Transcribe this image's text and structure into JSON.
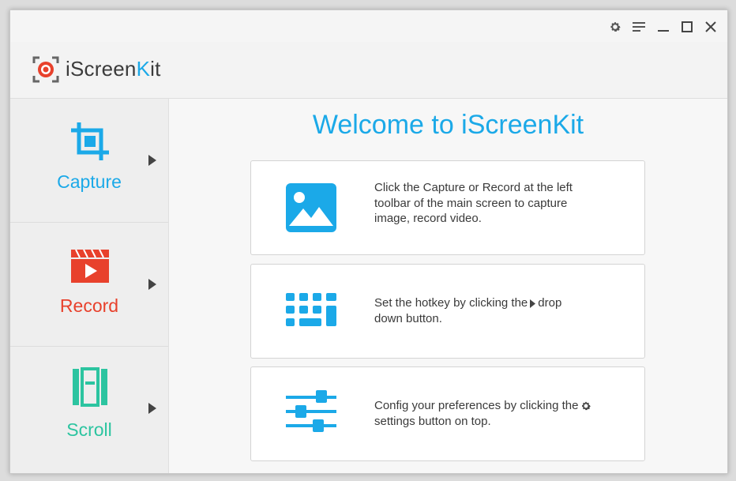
{
  "app": {
    "title_prefix": "iScreen",
    "title_k": "K",
    "title_suffix": "it"
  },
  "window_controls": [
    "gear-icon",
    "menu-icon",
    "minimize-icon",
    "maximize-icon",
    "close-icon"
  ],
  "sidebar": {
    "items": [
      {
        "label": "Capture",
        "icon": "crop-icon",
        "color": "#1ba9e8"
      },
      {
        "label": "Record",
        "icon": "video-record-icon",
        "color": "#e8412c"
      },
      {
        "label": "Scroll",
        "icon": "scroll-icon",
        "color": "#2cc4a0"
      }
    ]
  },
  "main": {
    "welcome": "Welcome to iScreenKit",
    "cards": [
      {
        "icon": "image-icon",
        "line1": "Click the Capture or Record at the left",
        "line2": "toolbar of the main screen to capture",
        "line3": "image, record video."
      },
      {
        "icon": "keyboard-icon",
        "line1_a": "Set the hotkey by clicking the",
        "line1_b": "drop",
        "line2": "down button."
      },
      {
        "icon": "sliders-icon",
        "line1": "Config your preferences by clicking the",
        "line2": "settings button on top."
      }
    ]
  },
  "colors": {
    "accent": "#1ba9e8",
    "record": "#e8412c",
    "scroll": "#2cc4a0"
  }
}
